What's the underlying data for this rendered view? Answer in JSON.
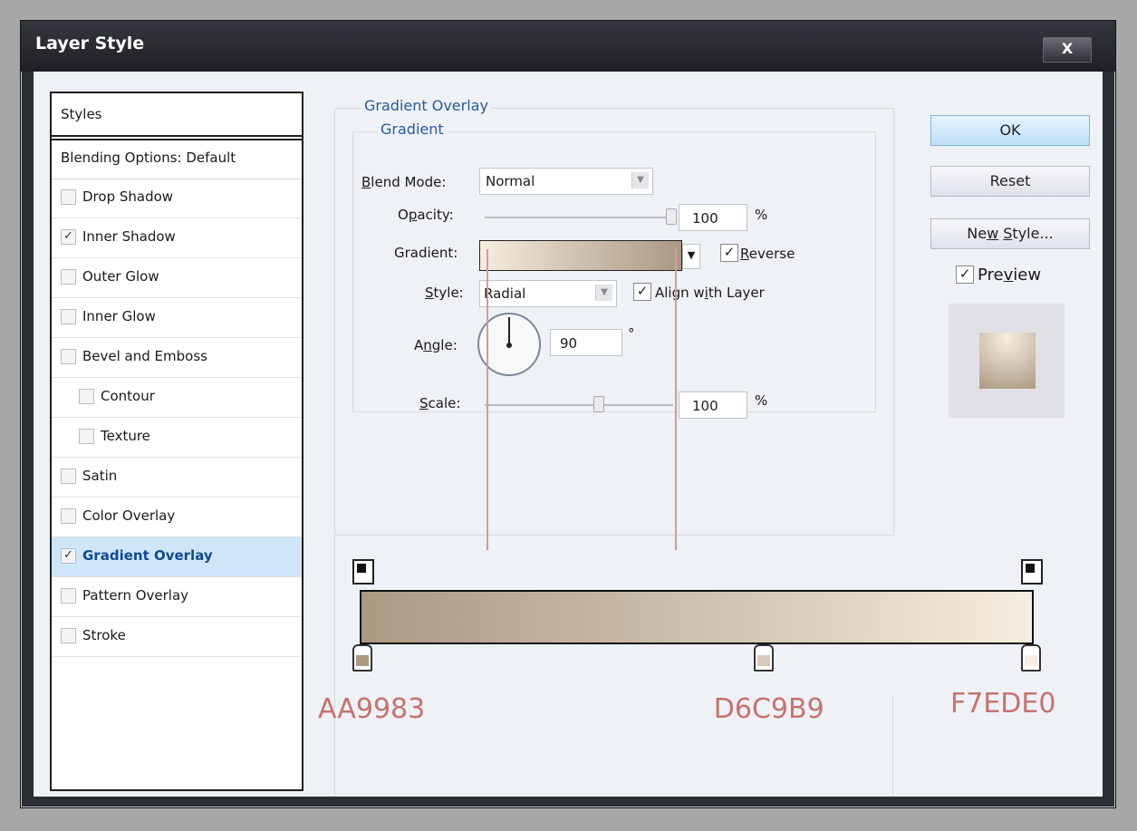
{
  "window": {
    "title": "Layer Style",
    "close_label": "X"
  },
  "styles_panel": {
    "header": "Styles",
    "blending_options": "Blending Options: Default",
    "items": [
      {
        "label": "Drop Shadow",
        "checked": false,
        "indent": false,
        "selected": false
      },
      {
        "label": "Inner Shadow",
        "checked": true,
        "indent": false,
        "selected": false
      },
      {
        "label": "Outer Glow",
        "checked": false,
        "indent": false,
        "selected": false
      },
      {
        "label": "Inner Glow",
        "checked": false,
        "indent": false,
        "selected": false
      },
      {
        "label": "Bevel and Emboss",
        "checked": false,
        "indent": false,
        "selected": false
      },
      {
        "label": "Contour",
        "checked": false,
        "indent": true,
        "selected": false
      },
      {
        "label": "Texture",
        "checked": false,
        "indent": true,
        "selected": false
      },
      {
        "label": "Satin",
        "checked": false,
        "indent": false,
        "selected": false
      },
      {
        "label": "Color Overlay",
        "checked": false,
        "indent": false,
        "selected": false
      },
      {
        "label": "Gradient Overlay",
        "checked": true,
        "indent": false,
        "selected": true
      },
      {
        "label": "Pattern Overlay",
        "checked": false,
        "indent": false,
        "selected": false
      },
      {
        "label": "Stroke",
        "checked": false,
        "indent": false,
        "selected": false
      }
    ]
  },
  "gradient_overlay": {
    "section_title": "Gradient Overlay",
    "subsection_title": "Gradient",
    "blend_mode_label_u": "B",
    "blend_mode_label_rest": "lend Mode:",
    "blend_mode_value": "Normal",
    "opacity_label_pre": "O",
    "opacity_label_u": "p",
    "opacity_label_rest": "acity:",
    "opacity_value": "100",
    "opacity_unit": "%",
    "gradient_label": "Gradient:",
    "reverse_label_u": "R",
    "reverse_label_rest": "everse",
    "reverse_checked": true,
    "style_label_u": "S",
    "style_label_rest": "tyle:",
    "style_value": "Radial",
    "align_label_pre": "Align w",
    "align_label_u": "i",
    "align_label_rest": "th Layer",
    "align_checked": true,
    "angle_label_pre": "A",
    "angle_label_u": "n",
    "angle_label_rest": "gle:",
    "angle_value": "90",
    "angle_unit": "°",
    "scale_label_u": "S",
    "scale_label_rest": "cale:",
    "scale_value": "100",
    "scale_unit": "%",
    "opacity_level": 1.0,
    "scale_level": 0.6
  },
  "buttons": {
    "ok": "OK",
    "reset": "Reset",
    "new_style_pre": "Ne",
    "new_style_u": "w",
    "new_style_mid": " ",
    "new_style_u2": "S",
    "new_style_rest": "tyle...",
    "preview_pre": "Pre",
    "preview_u": "v",
    "preview_rest": "iew",
    "preview_checked": true
  },
  "gradient_editor": {
    "stops": [
      {
        "hex_label": "AA9983",
        "color": "#AA9983",
        "position": 0
      },
      {
        "hex_label": "D6C9B9",
        "color": "#D6C9B9",
        "position": 0.6
      },
      {
        "hex_label": "F7EDE0",
        "color": "#F7EDE0",
        "position": 1
      }
    ]
  },
  "colors": {
    "accent": "#275c98",
    "selection": "#cfe6f8",
    "annotation": "#c5736f"
  }
}
